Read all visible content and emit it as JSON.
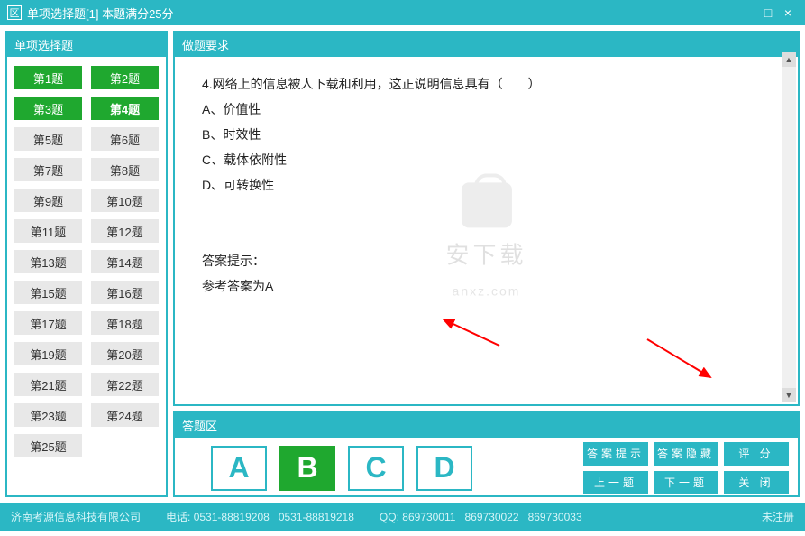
{
  "window": {
    "title": "单项选择题[1]    本题满分25分",
    "min": "—",
    "max": "□",
    "close": "×"
  },
  "sidebar": {
    "title": "单项选择题",
    "items": [
      {
        "label": "第1题",
        "state": "done"
      },
      {
        "label": "第2题",
        "state": "done"
      },
      {
        "label": "第3题",
        "state": "done"
      },
      {
        "label": "第4题",
        "state": "current"
      },
      {
        "label": "第5题",
        "state": ""
      },
      {
        "label": "第6题",
        "state": ""
      },
      {
        "label": "第7题",
        "state": ""
      },
      {
        "label": "第8题",
        "state": ""
      },
      {
        "label": "第9题",
        "state": ""
      },
      {
        "label": "第10题",
        "state": ""
      },
      {
        "label": "第11题",
        "state": ""
      },
      {
        "label": "第12题",
        "state": ""
      },
      {
        "label": "第13题",
        "state": ""
      },
      {
        "label": "第14题",
        "state": ""
      },
      {
        "label": "第15题",
        "state": ""
      },
      {
        "label": "第16题",
        "state": ""
      },
      {
        "label": "第17题",
        "state": ""
      },
      {
        "label": "第18题",
        "state": ""
      },
      {
        "label": "第19题",
        "state": ""
      },
      {
        "label": "第20题",
        "state": ""
      },
      {
        "label": "第21题",
        "state": ""
      },
      {
        "label": "第22题",
        "state": ""
      },
      {
        "label": "第23题",
        "state": ""
      },
      {
        "label": "第24题",
        "state": ""
      },
      {
        "label": "第25题",
        "state": ""
      }
    ]
  },
  "requirement": {
    "title": "做题要求",
    "question_line": "4.网络上的信息被人下载和利用，这正说明信息具有（　　）",
    "options": {
      "A": "A、价值性",
      "B": "B、时效性",
      "C": "C、载体依附性",
      "D": "D、可转换性"
    },
    "hint_label": "答案提示：",
    "hint_answer": "参考答案为A"
  },
  "watermark": {
    "line1": "安下载",
    "line2": "anxz.com"
  },
  "answer_area": {
    "title": "答题区",
    "choices": [
      "A",
      "B",
      "C",
      "D"
    ],
    "selected": "B",
    "buttons": {
      "show": "答案提示",
      "hide": "答案隐藏",
      "score": "评 分",
      "prev": "上一题",
      "next": "下一题",
      "close": "关 闭"
    }
  },
  "status": {
    "company": "济南考源信息科技有限公司",
    "tel_label": "电话:",
    "tel1": "0531-88819208",
    "tel2": "0531-88819218",
    "qq_label": "QQ:",
    "qq1": "869730011",
    "qq2": "869730022",
    "qq3": "869730033",
    "reg": "未注册"
  }
}
